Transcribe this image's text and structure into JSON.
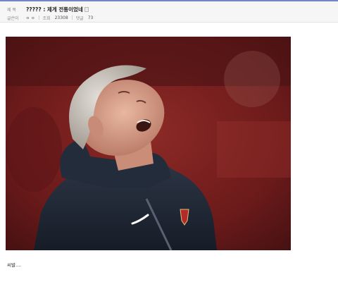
{
  "post": {
    "title_label": "제 목",
    "title": "????? : 제게 전통이었네",
    "author_label": "글쓴이",
    "author": "ㅇ ㅇ",
    "views_label": "조회",
    "views": "23308",
    "comments_label": "댓글",
    "comments": "73",
    "body_text": "씨발...."
  },
  "colors": {
    "accent_line": "#6f86c4",
    "header_bg": "#f6f6f6",
    "photo_background": "#7a1e1e"
  },
  "icons": {
    "title_attachment": "image-attachment-icon"
  }
}
